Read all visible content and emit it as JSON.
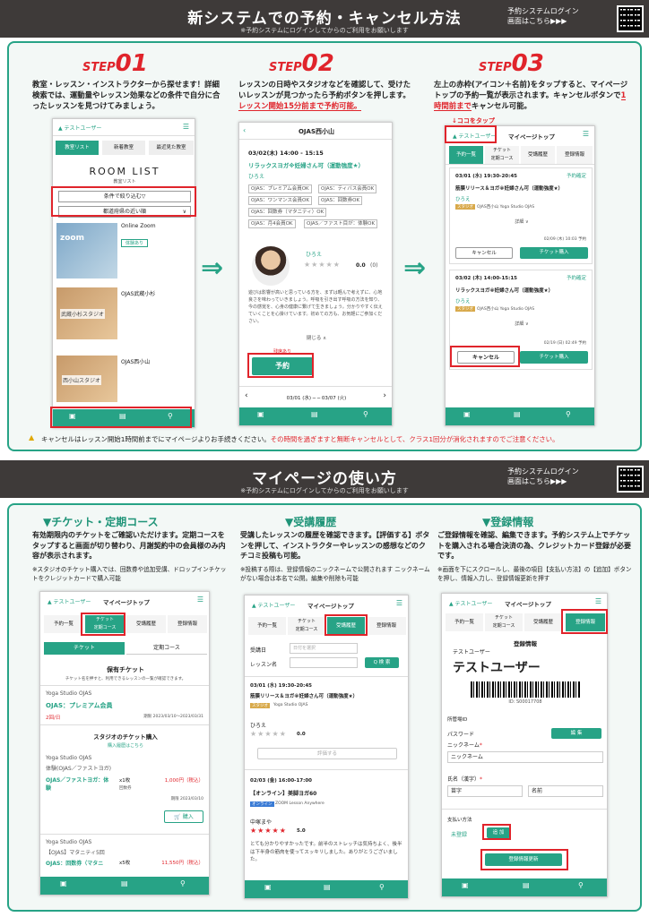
{
  "top": {
    "title": "新システムでの予約・キャンセル方法",
    "subtitle": "※予約システムにログインしてからのご利用をお願いします",
    "login": "予約システムログイン",
    "login2": "画面はこちら▶▶▶"
  },
  "step1": {
    "word": "STEP",
    "num": "01",
    "desc": "教室・レッスン・インストラクターから探せます！詳細検索では、運動量やレッスン効果などの条件で自分に合ったレッスンを見つけてみましょう。",
    "user": "テストユーザー",
    "tabs": [
      "教室リスト",
      "新着教室",
      "最近見た教室"
    ],
    "roomlist": "ROOM LIST",
    "roomsub": "教室リスト",
    "filter": "条件で絞り込む▽",
    "near": "都道府県の近い順",
    "studios": [
      "Online Zoom",
      "OJAS武蔵小杉",
      "OJAS西小山"
    ],
    "zoom": "zoom",
    "badge": "体験あり",
    "photo2": "武蔵小杉スタジオ",
    "photo3": "西小山スタジオ"
  },
  "step2": {
    "word": "STEP",
    "num": "02",
    "desc_a": "レッスンの日時やスタジオなどを確認して、受けたいレッスンが見つかったら予約ボタンを押します。",
    "desc_b": "レッスン開始15分前まで予約可能。",
    "studio": "OJAS西小山",
    "date": "03/02(木)  14:00 - 15:15",
    "lesson": "リラックスヨガ※妊婦さん可（運動強度★）",
    "inst": "ひろえ",
    "tags": [
      "OJAS：プレミアム会員OK",
      "OJAS：ティバス会員OK",
      "OJAS：ワンマンス会員OK",
      "OJAS：回数券OK",
      "OJAS：回数券（マタニティ）OK",
      "OJAS：月4会員OK",
      "OJAS／ファスト目が：体験OK"
    ],
    "name": "ひろえ",
    "rating": "0.0",
    "count": "(0)",
    "bio": "遊びは影響が高いと思っている方を、まずは軽んで考えずに、心地良さを味わっていきましょう。呼吸を引き出す呼吸の方法を知り、今の感覚を、心身の健康に繋げて生きましょう。分かりやすく伝えていくことを心掛けています。初めての方も、お気軽にご参加ください。",
    "close": "閉じる ∧",
    "remain": "残席あり",
    "reserve": "予約",
    "week": "03/01 (水) ─ ─ 03/07 (火)"
  },
  "step3": {
    "word": "STEP",
    "num": "03",
    "desc_a": "左上の赤枠(アイコン＋名前)をタップすると、マイページトップの予約一覧が表示されます。キャンセルボタンで",
    "desc_b": "1時間前まで",
    "desc_c": "キャンセル可能。",
    "coco": "↓ココをタップ",
    "user": "テストユーザー",
    "mytop": "マイページトップ",
    "tabs": [
      "予約一覧",
      "チケット\n定期コース",
      "受講履歴",
      "登録情報"
    ],
    "items": [
      {
        "date": "03/01 (水) 19:30-20:45",
        "status": "予約確定",
        "lesson": "筋膜リリース＆ヨガ※妊婦さん可（運動強度★）",
        "inst": "ひろえ",
        "studio": "OJAS西小山  Yoga Studio OJAS",
        "detail": "詳細 ∨",
        "time": "02/09 (木) 10:03 予約",
        "cancel": "キャンセル",
        "ticket": "チケット購入"
      },
      {
        "date": "03/02 (木) 14:00-15:15",
        "status": "予約確定",
        "lesson": "リラックスヨガ※妊婦さん可（運動強度★）",
        "inst": "ひろえ",
        "studio": "OJAS西小山  Yoga Studio OJAS",
        "detail": "詳細 ∨",
        "time": "02/19 (日) 02:49 予約",
        "cancel": "キャンセル",
        "ticket": "チケット購入"
      }
    ],
    "badge": "スタジオ"
  },
  "warning": {
    "a": "キャンセルはレッスン開始1時間前までにマイページよりお手続きください。",
    "b": "その時間を過ぎますと無断キャンセルとして、クラス1回分が消化されますのでご注意ください。"
  },
  "mid": {
    "title": "マイページの使い方",
    "subtitle": "※予約システムにログインしてからのご利用をお願いします",
    "login": "予約システムログイン",
    "login2": "画面はこちら▶▶▶"
  },
  "col1": {
    "head": "▼チケット・定期コース",
    "desc": "有効期限内のチケットをご確認いただけます。定期コースをタップすると画面が切り替わり、月謝契約中の会員様のみ内容が表示されます。",
    "note": "※スタジオのチケット購入では、回数券や追加受講、ドロップインチケットをクレジットカードで購入可能",
    "user": "テストユーザー",
    "mytop": "マイページトップ",
    "tabs": [
      "予約一覧",
      "チケット\n定期コース",
      "受講履歴",
      "登録情報"
    ],
    "sub": [
      "チケット",
      "定期コース"
    ],
    "owned": "保有チケット",
    "ownednote": "チケット名を押すと、利用できるレッスンの一覧が確認できます。",
    "yoj": "Yoga Studio OJAS",
    "plan": "OJAS：プレミアム会員",
    "plancount": "2回/日",
    "period": "期限 2023/03/10〜2023/03/31",
    "buyhead": "スタジオのチケット購入",
    "buynote": "購入履歴はこちら",
    "s1": "Yoga Studio OJAS",
    "s1b": "体験(OJAS／ファストヨガ)",
    "t1": "OJAS／ファストヨガ：体験",
    "q1": "x1枚",
    "p1": "1,000円（税込）",
    "k1": "回数券",
    "e1": "期限 2023/03/10",
    "buy": "購入",
    "s2": "Yoga Studio OJAS",
    "s2b": "【OJAS】マタニティ5回",
    "t2": "OJAS：回数券（マタニ",
    "q2": "x5枚",
    "p2": "11,550円（税込）"
  },
  "col2": {
    "head": "▼受講履歴",
    "desc": "受講したレッスンの履歴を確認できます。【評価する】ボタンを押して、インストラクターやレッスンの感想などのクチコミ投稿も可能。",
    "note": "※投稿する際は、登録情報のニックネームで公開されます ニックネームがない場合は本名で公開。編集や削除も可能",
    "user": "テストユーザー",
    "mytop": "マイページトップ",
    "tabs": [
      "予約一覧",
      "チケット\n定期コース",
      "受講履歴",
      "登録情報"
    ],
    "datelabel": "受講日",
    "dateph": "日付を選択",
    "lessonlabel": "レッスン名",
    "search": "Q 検 索",
    "r1date": "03/01 (水) 19:30-20:45",
    "r1name": "筋膜リリース＆ヨガ※妊婦さん可（運動強度★）",
    "r1studio": "Yoga Studio OJAS",
    "r1badge": "スタジオ",
    "r1inst": "ひろえ",
    "r1score": "0.0",
    "review": "評価する",
    "r2date": "02/03 (金) 16:00-17:00",
    "r2name": "【オンライン】美脚ヨガ60",
    "r2badge": "オンライン",
    "r2studio": "ZOOM  Lesson Anywhere",
    "r2inst": "中塚まや",
    "r2score": "5.0",
    "r2comment": "とても分かりやすかったです。前半のストレッチは気持ちよく、後半は下半身の筋肉を使ってスッキリしました。ありがとうございました。"
  },
  "col3": {
    "head": "▼登録情報",
    "desc": "ご登録情報を確認、編集できます。予約システム上でチケットを購入される場合決済の為、クレジットカード登録が必要です。",
    "note": "※画面を下にスクロールし、最後の項目【支払い方法】の【追加】ボタンを押し、情報入力し、登録情報更新を押す",
    "user": "テストユーザー",
    "mytop": "マイページトップ",
    "tabs": [
      "予約一覧",
      "チケット\n定期コース",
      "受講履歴",
      "登録情報"
    ],
    "reghead": "登録情報",
    "small": "テストユーザー",
    "big": "テストユーザー",
    "id": "ID: S00017708",
    "mgmt": "所管場ID",
    "pw": "パスワード",
    "edit": "編 集",
    "nick": "ニックネーム",
    "nickval": "ニックネーム",
    "namelabel": "氏名（漢字）",
    "last": "苗字",
    "first": "名前",
    "pay": "支払い方法",
    "unreg": "未登録",
    "add": "追 加",
    "update": "登録情報更新"
  }
}
